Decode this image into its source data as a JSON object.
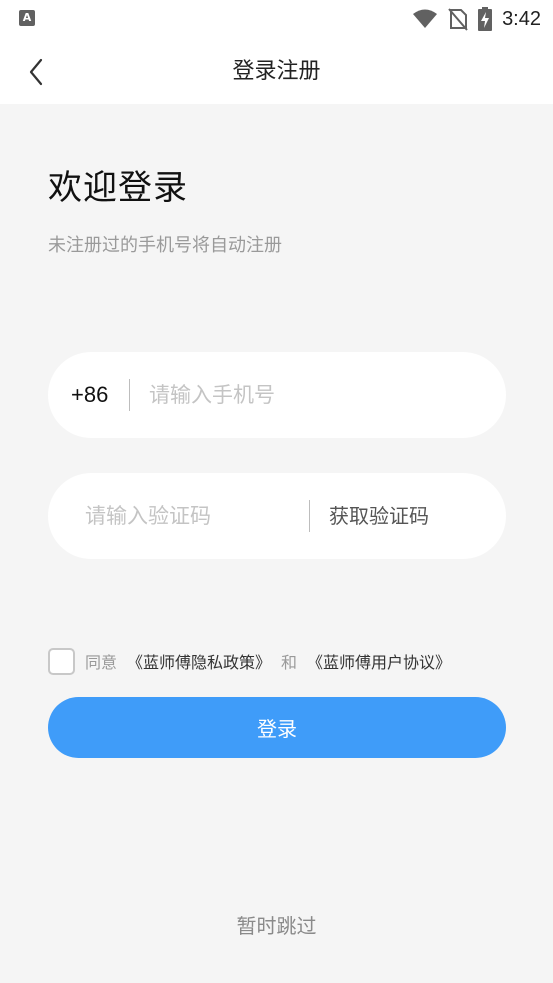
{
  "status_bar": {
    "app_icon": "A",
    "time": "3:42",
    "icons": [
      "wifi-icon",
      "no-sim-icon",
      "battery-charging-icon"
    ]
  },
  "header": {
    "back_icon": "chevron-left-icon",
    "title": "登录注册"
  },
  "welcome": {
    "title": "欢迎登录",
    "subtitle": "未注册过的手机号将自动注册"
  },
  "phone": {
    "country_code": "+86",
    "placeholder": "请输入手机号"
  },
  "code": {
    "placeholder": "请输入验证码",
    "get_code_label": "获取验证码"
  },
  "agreement": {
    "checked": false,
    "agree_text": "同意",
    "privacy_link": "《蓝师傅隐私政策》",
    "and_text": "和",
    "user_link": "《蓝师傅用户协议》"
  },
  "login_label": "登录",
  "skip_label": "暂时跳过",
  "colors": {
    "primary": "#3f9cf9",
    "background": "#f5f5f5"
  }
}
